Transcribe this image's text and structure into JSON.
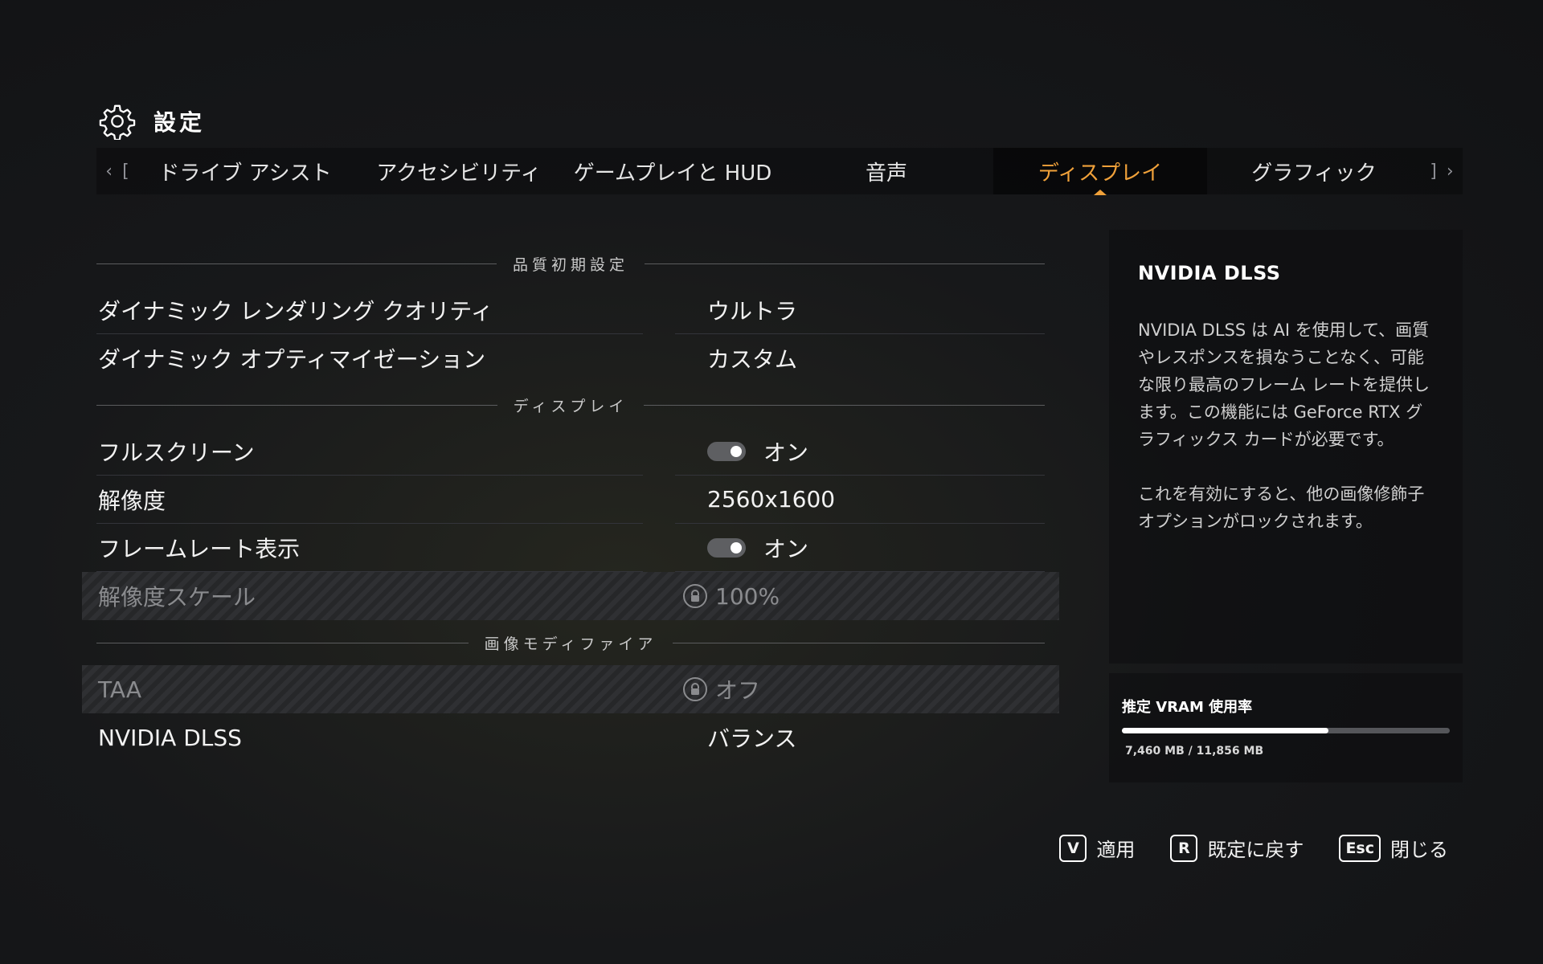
{
  "header": {
    "title": "設定",
    "icon": "gear-icon"
  },
  "tabs": {
    "prev_icon": "‹",
    "prev_bracket": "[",
    "next_bracket": "]",
    "next_icon": "›",
    "items": [
      {
        "label": "ドライブ アシスト"
      },
      {
        "label": "アクセシビリティ"
      },
      {
        "label": "ゲームプレイと HUD"
      },
      {
        "label": "音声"
      },
      {
        "label": "ディスプレイ",
        "active": true
      },
      {
        "label": "グラフィック"
      }
    ]
  },
  "sections": {
    "quality": "品質初期設定",
    "display": "ディスプレイ",
    "modifiers": "画像モディファイア"
  },
  "settings": {
    "dynamic_rendering": {
      "label": "ダイナミック レンダリング クオリティ",
      "value": "ウルトラ"
    },
    "dynamic_optimization": {
      "label": "ダイナミック オプティマイゼーション",
      "value": "カスタム"
    },
    "fullscreen": {
      "label": "フルスクリーン",
      "value": "オン",
      "on": true
    },
    "resolution": {
      "label": "解像度",
      "value": "2560x1600"
    },
    "framerate": {
      "label": "フレームレート表示",
      "value": "オン",
      "on": true
    },
    "resolution_scale": {
      "label": "解像度スケール",
      "value": "100%",
      "locked": true
    },
    "taa": {
      "label": "TAA",
      "value": "オフ",
      "locked": true
    },
    "dlss": {
      "label": "NVIDIA DLSS",
      "value": "バランス"
    }
  },
  "info": {
    "title": "NVIDIA DLSS",
    "paragraph1": "NVIDIA DLSS は AI を使用して、画質やレスポンスを損なうことなく、可能な限り最高のフレーム レートを提供します。この機能には GeForce RTX グラフィックス カードが必要です。",
    "paragraph2": "これを有効にすると、他の画像修飾子オプションがロックされます。"
  },
  "vram": {
    "label": "推定 VRAM 使用率",
    "amount": "7,460 MB / 11,856 MB",
    "used_mb": 7460,
    "total_mb": 11856
  },
  "footer": {
    "apply": {
      "key": "V",
      "label": "適用"
    },
    "reset": {
      "key": "R",
      "label": "既定に戻す"
    },
    "close": {
      "key": "Esc",
      "label": "閉じる"
    }
  },
  "colors": {
    "accent": "#f0a13a"
  }
}
